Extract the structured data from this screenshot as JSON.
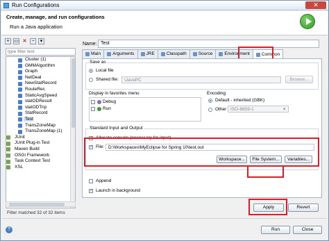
{
  "window": {
    "title": "Run Configurations"
  },
  "header": {
    "title": "Create, manage, and run configurations",
    "subtitle": "Run a Java application"
  },
  "left": {
    "filter_placeholder": "type filter text",
    "items": [
      "Cluster (1)",
      "GMMAlgorithm",
      "Graph",
      "NetDeal",
      "NewStatRecord",
      "RouteRec",
      "StaticAvgSpeed",
      "statODResult",
      "statODTrip",
      "StatRecord",
      "Test",
      "TransZoneMap",
      "TransZoneMap (1)"
    ],
    "categories": [
      "JUnit",
      "JUnit Plug-in Test",
      "Maven Build",
      "OSGi Framework",
      "Task Context Test",
      "XSL"
    ],
    "status": "Filter matched 32 of 32 items"
  },
  "name_label": "Name:",
  "name_value": "Test",
  "tabs": [
    "Main",
    "Arguments",
    "JRE",
    "Classpath",
    "Source",
    "Environment",
    "Common"
  ],
  "save_as": {
    "label": "Save as",
    "local": "Local file",
    "shared": "Shared file:",
    "shared_value": "\\JavaPC",
    "browse": "Browse..."
  },
  "favorites": {
    "label": "Display in favorites menu",
    "items": [
      "Debug",
      "Run"
    ]
  },
  "encoding": {
    "label": "Encoding",
    "default": "Default - inherited (GBK)",
    "other": "Other",
    "other_value": "ISO-8859-1"
  },
  "io": {
    "label": "Standard Input and Output",
    "allocate": "Allocate console (necessary for input)",
    "file_label": "File:",
    "file_value": "D:\\Workspaces\\MyEclipse for Spring 10\\test.out",
    "workspace": "Workspace...",
    "filesystem": "File System...",
    "variables": "Variables...",
    "append": "Append"
  },
  "launch_bg": "Launch in background",
  "apply": "Apply",
  "revert": "Revert",
  "run": "Run",
  "close": "Close"
}
